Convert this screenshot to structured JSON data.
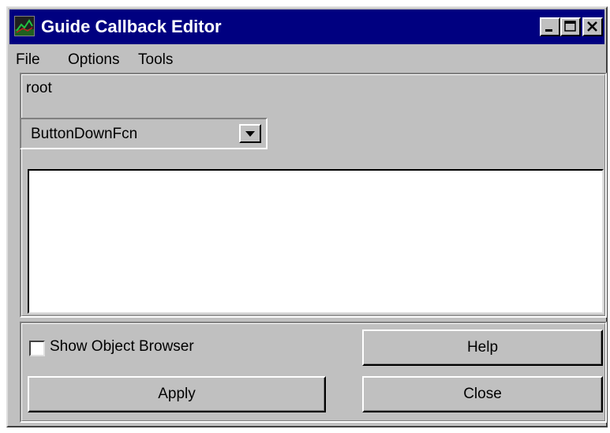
{
  "window": {
    "title": "Guide Callback Editor"
  },
  "titlebar_buttons": {
    "minimize_icon": "minimize-icon",
    "maximize_icon": "maximize-icon",
    "close_icon": "close-icon"
  },
  "menubar": {
    "items": [
      {
        "label": "File"
      },
      {
        "label": "Options"
      },
      {
        "label": "Tools"
      }
    ]
  },
  "editor": {
    "object_label": "root",
    "callback_select": {
      "selected": "ButtonDownFcn"
    },
    "code_text": ""
  },
  "footer": {
    "show_object_browser_label": "Show Object Browser",
    "show_object_browser_checked": false,
    "help_label": "Help",
    "apply_label": "Apply",
    "close_label": "Close"
  },
  "colors": {
    "titlebar": "#000080",
    "face": "#c0c0c0"
  }
}
